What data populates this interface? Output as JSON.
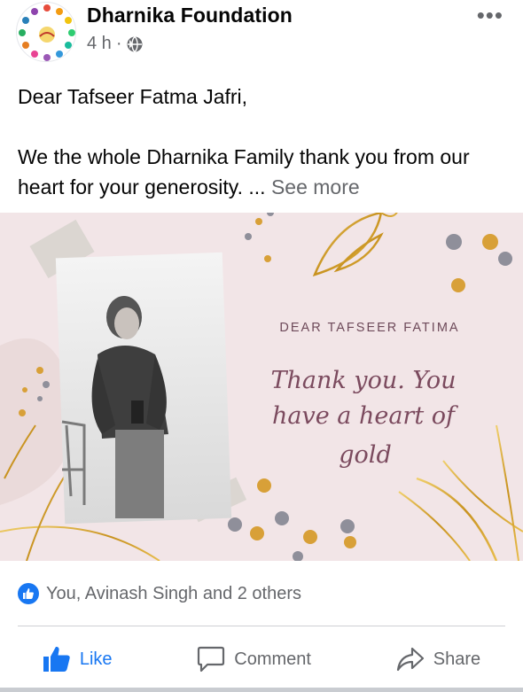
{
  "post": {
    "page_name": "Dharnika Foundation",
    "time": "4 h",
    "separator": "·",
    "greeting": "Dear Tafseer Fatma Jafri,",
    "body": "We the whole Dharnika Family thank you from our heart for your generosity. ...",
    "see_more": "See more",
    "more_icon": "•••"
  },
  "card": {
    "heading": "DEAR TAFSEER FATIMA",
    "line1": "Thank you. You",
    "line2": "have a heart of",
    "line3": "gold"
  },
  "reactions": {
    "summary": "You, Avinash Singh and 2 others"
  },
  "actions": {
    "like": "Like",
    "comment": "Comment",
    "share": "Share"
  },
  "colors": {
    "accent": "#1877f2",
    "muted": "#65676b",
    "card_bg": "#f2e5e7",
    "gold": "#d9a62e",
    "script_text": "#7b4a5e"
  }
}
